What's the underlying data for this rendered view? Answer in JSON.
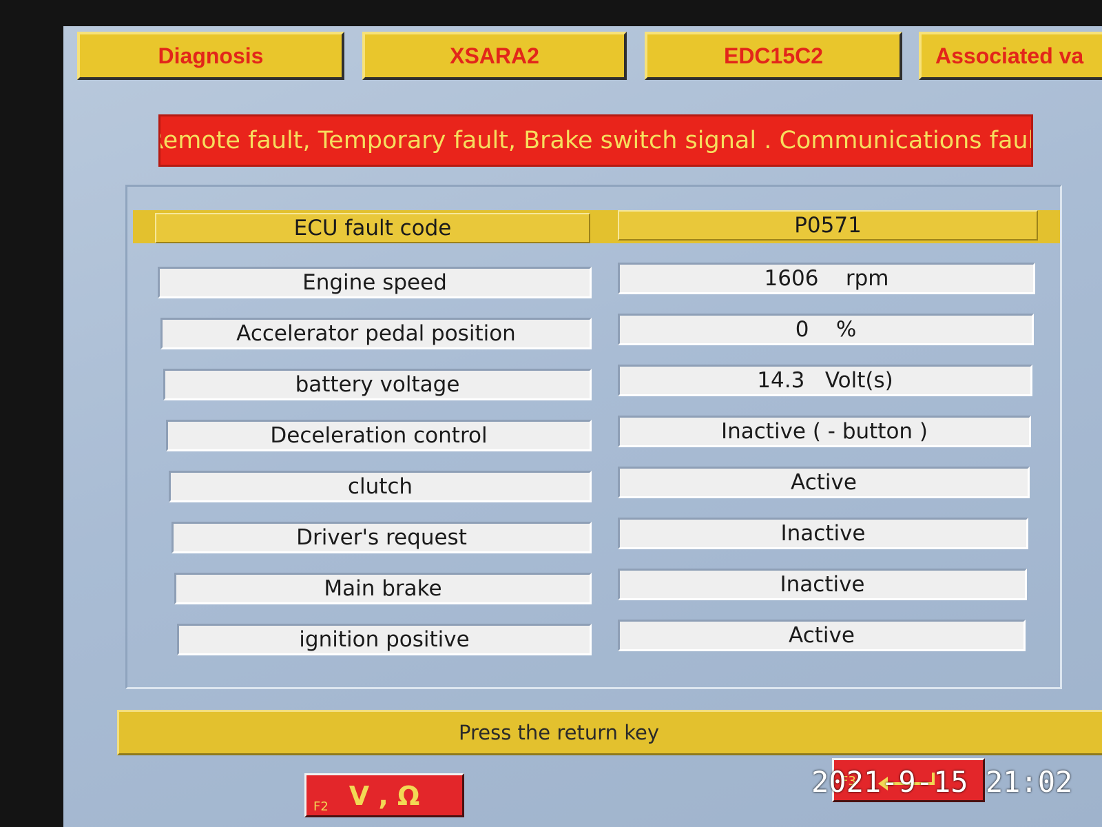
{
  "tabs": [
    {
      "label": "Diagnosis"
    },
    {
      "label": "XSARA2"
    },
    {
      "label": "EDC15C2"
    },
    {
      "label": "Associated va"
    }
  ],
  "fault_banner": "Remote fault, Temporary fault, Brake switch signal . Communications fault",
  "table": {
    "header": {
      "label": "ECU fault code",
      "value": "P0571"
    },
    "rows": [
      {
        "label": "Engine speed",
        "value": "1606    rpm"
      },
      {
        "label": "Accelerator pedal position",
        "value": "0    %"
      },
      {
        "label": "battery voltage",
        "value": "14.3   Volt(s)"
      },
      {
        "label": "Deceleration control",
        "value": "Inactive ( - button )"
      },
      {
        "label": "clutch",
        "value": "Active"
      },
      {
        "label": "Driver's request",
        "value": "Inactive"
      },
      {
        "label": "Main brake",
        "value": "Inactive"
      },
      {
        "label": "ignition positive",
        "value": "Active"
      }
    ]
  },
  "footer": {
    "message": "Press the return key"
  },
  "function_keys": [
    {
      "key": "F2",
      "symbol": "V , Ω"
    },
    {
      "key": "F3",
      "icon": "return-arrow-icon"
    }
  ],
  "timestamp": "2021-9-15 21:02",
  "colors": {
    "tab_bg": "#e9c62c",
    "tab_text": "#e2261a",
    "fault_bg": "#e9241b",
    "fault_text": "#f6de5e",
    "header_yellow": "#e9c83a",
    "screen_blue": "#a9bcd4",
    "function_key_red": "#e3262a"
  }
}
